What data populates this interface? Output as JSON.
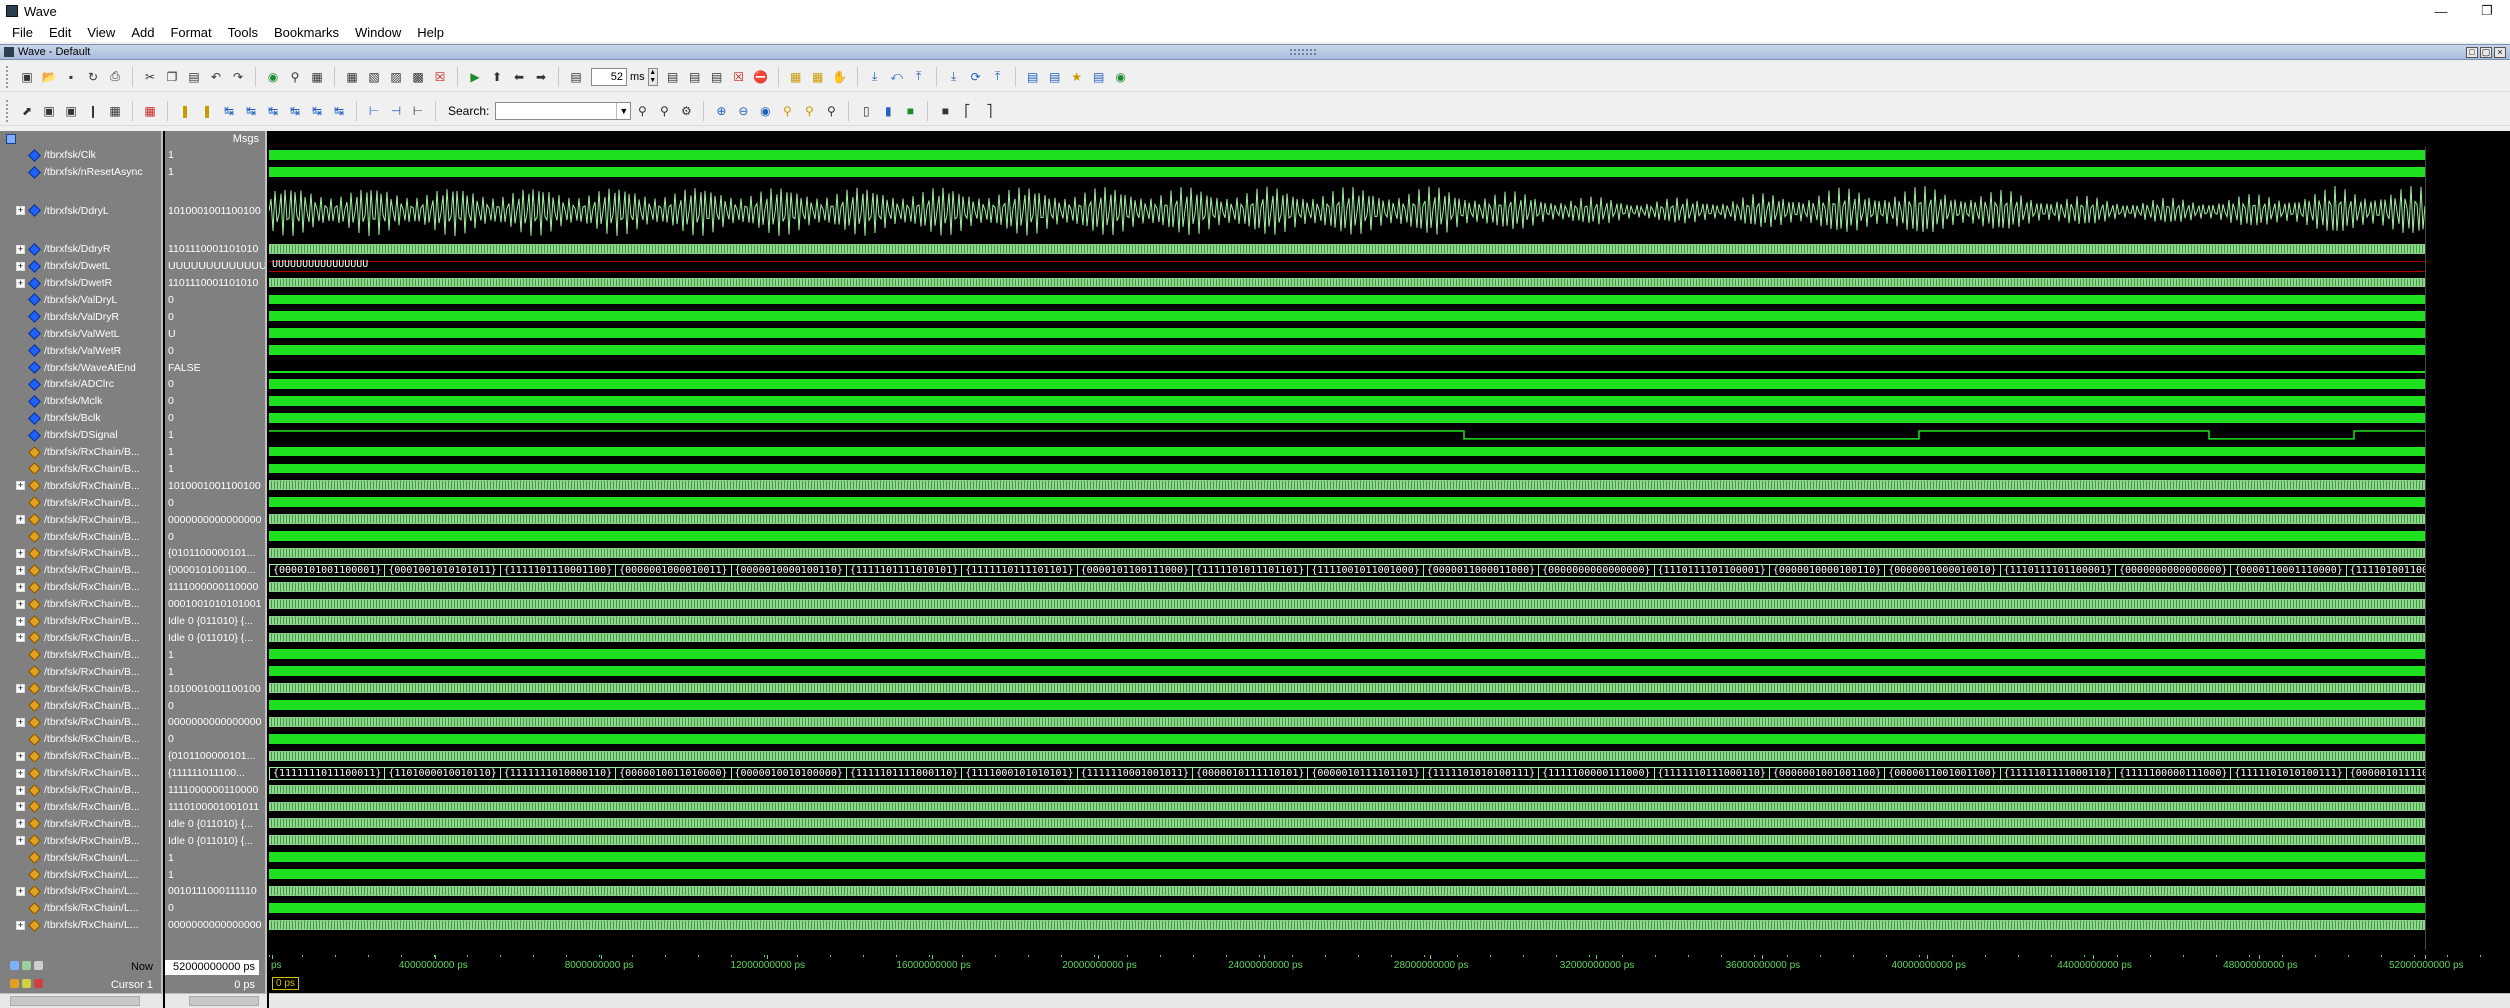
{
  "window": {
    "title": "Wave"
  },
  "menu": [
    "File",
    "Edit",
    "View",
    "Add",
    "Format",
    "Tools",
    "Bookmarks",
    "Window",
    "Help"
  ],
  "subwindow": {
    "title": "Wave - Default"
  },
  "toolbar": {
    "zoom_value": "52",
    "zoom_unit": "ms",
    "search_label": "Search:",
    "search_value": ""
  },
  "pane": {
    "msgs_header": "Msgs"
  },
  "signals": [
    {
      "name": "/tbrxfsk/Clk",
      "value": "1",
      "kind": "clk",
      "expand": false,
      "icon": "blue"
    },
    {
      "name": "/tbrxfsk/nResetAsync",
      "value": "1",
      "kind": "high",
      "expand": false,
      "icon": "blue"
    },
    {
      "name": "/tbrxfsk/DdryL",
      "value": "1010001001100100",
      "kind": "analog",
      "expand": true,
      "icon": "blue"
    },
    {
      "name": "/tbrxfsk/DdryR",
      "value": "1101110001101010",
      "kind": "bus",
      "expand": true,
      "icon": "blue"
    },
    {
      "name": "/tbrxfsk/DwetL",
      "value": "UUUUUUUUUUUUUUUU",
      "kind": "undef",
      "expand": true,
      "icon": "blue"
    },
    {
      "name": "/tbrxfsk/DwetR",
      "value": "1101110001101010",
      "kind": "bus",
      "expand": true,
      "icon": "blue"
    },
    {
      "name": "/tbrxfsk/ValDryL",
      "value": "0",
      "kind": "clk",
      "expand": false,
      "icon": "blue"
    },
    {
      "name": "/tbrxfsk/ValDryR",
      "value": "0",
      "kind": "clk",
      "expand": false,
      "icon": "blue"
    },
    {
      "name": "/tbrxfsk/ValWetL",
      "value": "U",
      "kind": "clk",
      "expand": false,
      "icon": "blue"
    },
    {
      "name": "/tbrxfsk/ValWetR",
      "value": "0",
      "kind": "clk",
      "expand": false,
      "icon": "blue"
    },
    {
      "name": "/tbrxfsk/WaveAtEnd",
      "value": "FALSE",
      "kind": "low",
      "expand": false,
      "icon": "blue"
    },
    {
      "name": "/tbrxfsk/ADClrc",
      "value": "0",
      "kind": "clk",
      "expand": false,
      "icon": "blue"
    },
    {
      "name": "/tbrxfsk/Mclk",
      "value": "0",
      "kind": "clk",
      "expand": false,
      "icon": "blue"
    },
    {
      "name": "/tbrxfsk/Bclk",
      "value": "0",
      "kind": "clk",
      "expand": false,
      "icon": "blue"
    },
    {
      "name": "/tbrxfsk/DSignal",
      "value": "1",
      "kind": "dsig",
      "expand": false,
      "icon": "blue"
    },
    {
      "name": "/tbrxfsk/RxChain/B...",
      "value": "1",
      "kind": "clk",
      "expand": false,
      "icon": "orange"
    },
    {
      "name": "/tbrxfsk/RxChain/B...",
      "value": "1",
      "kind": "clk",
      "expand": false,
      "icon": "orange"
    },
    {
      "name": "/tbrxfsk/RxChain/B...",
      "value": "1010001001100100",
      "kind": "bus",
      "expand": true,
      "icon": "orange"
    },
    {
      "name": "/tbrxfsk/RxChain/B...",
      "value": "0",
      "kind": "clk",
      "expand": false,
      "icon": "orange"
    },
    {
      "name": "/tbrxfsk/RxChain/B...",
      "value": "0000000000000000",
      "kind": "bus",
      "expand": true,
      "icon": "orange"
    },
    {
      "name": "/tbrxfsk/RxChain/B...",
      "value": "0",
      "kind": "clk",
      "expand": false,
      "icon": "orange"
    },
    {
      "name": "/tbrxfsk/RxChain/B...",
      "value": "{0101100000101...",
      "kind": "bus",
      "expand": true,
      "icon": "orange"
    },
    {
      "name": "/tbrxfsk/RxChain/B...",
      "value": "{0000101001100...",
      "kind": "bustext1",
      "expand": true,
      "icon": "orange"
    },
    {
      "name": "/tbrxfsk/RxChain/B...",
      "value": "1111000000110000",
      "kind": "bus",
      "expand": true,
      "icon": "orange"
    },
    {
      "name": "/tbrxfsk/RxChain/B...",
      "value": "0001001010101001",
      "kind": "bus",
      "expand": true,
      "icon": "orange"
    },
    {
      "name": "/tbrxfsk/RxChain/B...",
      "value": "Idle 0 {011010} {...",
      "kind": "bus",
      "expand": true,
      "icon": "orange"
    },
    {
      "name": "/tbrxfsk/RxChain/B...",
      "value": "Idle 0 {011010} {...",
      "kind": "bus",
      "expand": true,
      "icon": "orange"
    },
    {
      "name": "/tbrxfsk/RxChain/B...",
      "value": "1",
      "kind": "clk",
      "expand": false,
      "icon": "orange"
    },
    {
      "name": "/tbrxfsk/RxChain/B...",
      "value": "1",
      "kind": "clk",
      "expand": false,
      "icon": "orange"
    },
    {
      "name": "/tbrxfsk/RxChain/B...",
      "value": "1010001001100100",
      "kind": "bus",
      "expand": true,
      "icon": "orange"
    },
    {
      "name": "/tbrxfsk/RxChain/B...",
      "value": "0",
      "kind": "clk",
      "expand": false,
      "icon": "orange"
    },
    {
      "name": "/tbrxfsk/RxChain/B...",
      "value": "0000000000000000",
      "kind": "bus",
      "expand": true,
      "icon": "orange"
    },
    {
      "name": "/tbrxfsk/RxChain/B...",
      "value": "0",
      "kind": "clk",
      "expand": false,
      "icon": "orange"
    },
    {
      "name": "/tbrxfsk/RxChain/B...",
      "value": "{0101100000101...",
      "kind": "bus",
      "expand": true,
      "icon": "orange"
    },
    {
      "name": "/tbrxfsk/RxChain/B...",
      "value": "{111111011100...",
      "kind": "bustext2",
      "expand": true,
      "icon": "orange"
    },
    {
      "name": "/tbrxfsk/RxChain/B...",
      "value": "1111000000110000",
      "kind": "bus",
      "expand": true,
      "icon": "orange"
    },
    {
      "name": "/tbrxfsk/RxChain/B...",
      "value": "1110100001001011",
      "kind": "bus",
      "expand": true,
      "icon": "orange"
    },
    {
      "name": "/tbrxfsk/RxChain/B...",
      "value": "Idle 0 {011010} {...",
      "kind": "bus",
      "expand": true,
      "icon": "orange"
    },
    {
      "name": "/tbrxfsk/RxChain/B...",
      "value": "Idle 0 {011010} {...",
      "kind": "bus",
      "expand": true,
      "icon": "orange"
    },
    {
      "name": "/tbrxfsk/RxChain/L...",
      "value": "1",
      "kind": "clk",
      "expand": false,
      "icon": "orange"
    },
    {
      "name": "/tbrxfsk/RxChain/L...",
      "value": "1",
      "kind": "clk",
      "expand": false,
      "icon": "orange"
    },
    {
      "name": "/tbrxfsk/RxChain/L...",
      "value": "0010111000111110",
      "kind": "bus",
      "expand": true,
      "icon": "orange"
    },
    {
      "name": "/tbrxfsk/RxChain/L...",
      "value": "0",
      "kind": "clk",
      "expand": false,
      "icon": "orange"
    },
    {
      "name": "/tbrxfsk/RxChain/L...",
      "value": "0000000000000000",
      "kind": "bus",
      "expand": true,
      "icon": "orange"
    }
  ],
  "bus_text_row1": [
    "{0000101001100001}",
    "{0001001010101011}",
    "{1111101110001100}",
    "{0000001000010011}",
    "{0000010000100110}",
    "{1111101111010101}",
    "{1111110111101101}",
    "{0000101100111000}",
    "{1111101011101101}",
    "{1111001011001000}",
    "{0000011000011000}",
    "{0000000000000000}",
    "{1110111101100001}",
    "{0000010000100110}",
    "{0000001000010010}",
    "{1110111101100001}",
    "{0000000000000000}",
    "{0000110001110000}",
    "{1111010011001000}",
    "{1111101110..."
  ],
  "bus_text_row2": [
    "{1111111011100011}",
    "{1101000010010110}",
    "{1111111010000110}",
    "{0000010011010000}",
    "{0000010010100000}",
    "{1111101111000110}",
    "{1111000101010101}",
    "{1111110001001011}",
    "{0000010111110101}",
    "{0000010111101101}",
    "{1111101010100111}",
    "{1111100000111000}",
    "{1111110111000110}",
    "{0000001001001100}",
    "{0000011001001100}",
    "{1111101111000110}",
    "{1111100000111000}",
    "{1111101010100111}",
    "{0000010111101101}",
    "{0000010111..."
  ],
  "bottom": {
    "now_label": "Now",
    "now_value": "52000000000 ps",
    "cursor_label": "Cursor 1",
    "cursor_value": "0 ps",
    "cursor_box": "0 ps"
  },
  "time_ticks": [
    "ps",
    "4000000000 ps",
    "8000000000 ps",
    "12000000000 ps",
    "16000000000 ps",
    "20000000000 ps",
    "24000000000 ps",
    "28000000000 ps",
    "32000000000 ps",
    "36000000000 ps",
    "40000000000 ps",
    "44000000000 ps",
    "48000000000 ps",
    "52000000000 ps"
  ],
  "colors": {
    "wave_green": "#1fe01f",
    "bus_green": "#9ff09f",
    "undef_red": "#b00000",
    "diamond_blue": "#1e63ff",
    "cursor_yellow": "#d4c000"
  }
}
